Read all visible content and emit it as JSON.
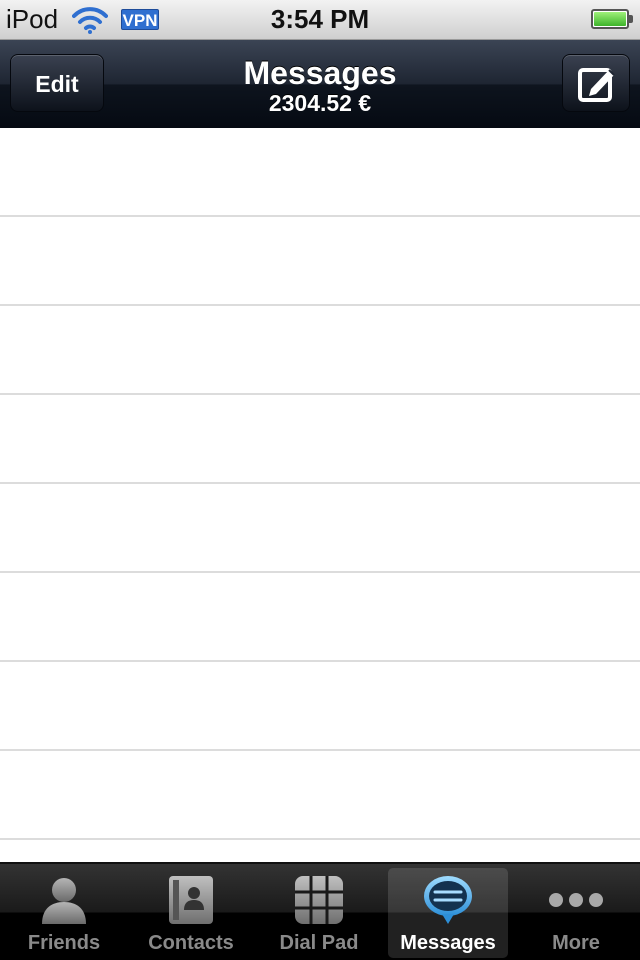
{
  "status_bar": {
    "carrier": "iPod",
    "vpn": "VPN",
    "time": "3:54 PM"
  },
  "nav": {
    "edit_label": "Edit",
    "title": "Messages",
    "balance": "2304.52 €"
  },
  "messages": {
    "rows": 8
  },
  "tabs": [
    {
      "label": "Friends",
      "icon": "person-icon",
      "selected": false
    },
    {
      "label": "Contacts",
      "icon": "address-book-icon",
      "selected": false
    },
    {
      "label": "Dial Pad",
      "icon": "keypad-icon",
      "selected": false
    },
    {
      "label": "Messages",
      "icon": "speech-bubble-icon",
      "selected": true
    },
    {
      "label": "More",
      "icon": "more-dots-icon",
      "selected": false
    }
  ],
  "colors": {
    "nav_bar": "#1e2532",
    "tab_bar": "#000000",
    "selected_tab_label": "#ffffff",
    "unselected_tab_label": "#8a8a8a",
    "message_accent": "#3da5e8",
    "vpn_badge": "#2f6fd0",
    "battery": "#3cb42a"
  }
}
